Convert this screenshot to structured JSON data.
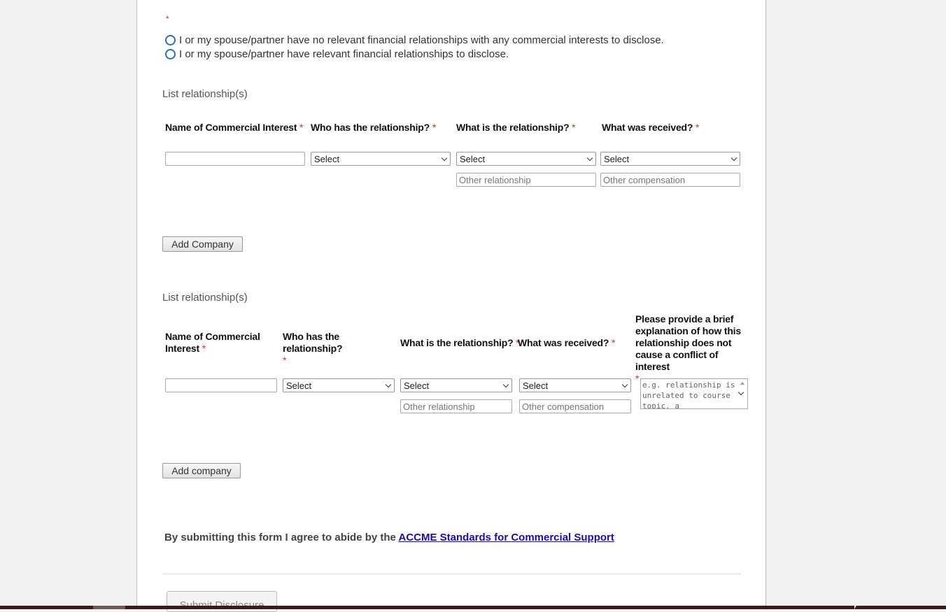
{
  "disclosure": {
    "required_mark": "*",
    "options": [
      {
        "label": "I or my spouse/partner have no relevant financial relationships with any commercial interests to disclose."
      },
      {
        "label": "I or my spouse/partner have relevant financial relationships to disclose."
      }
    ]
  },
  "section1": {
    "title": "List relationship(s)",
    "columns": {
      "name": "Name of Commercial Interest",
      "who": "Who has the relationship?",
      "what": "What is the relationship?",
      "received": "What was received?"
    },
    "who_select": "Select",
    "what_select": "Select",
    "received_select": "Select",
    "other_relationship_placeholder": "Other relationship",
    "other_compensation_placeholder": "Other compensation",
    "add_button": "Add Company"
  },
  "section2": {
    "title": "List relationship(s)",
    "columns": {
      "name": "Name of Commercial Interest",
      "who": "Who has the relationship?",
      "what": "What is the relationship?",
      "received": "What was received?",
      "explanation": "Please provide a brief explanation of how this relationship does not cause a conflict of interest"
    },
    "who_select": "Select",
    "what_select": "Select",
    "received_select": "Select",
    "other_relationship_placeholder": "Other relationship",
    "other_compensation_placeholder": "Other compensation",
    "explanation_placeholder": "e.g. relationship is unrelated to course topic, a",
    "add_button": "Add company"
  },
  "agreement": {
    "text": "By submitting this form I agree to abide by the ",
    "link": "ACCME Standards for Commercial Support"
  },
  "submit_label": "Submit Disclosure",
  "required_star": "*"
}
